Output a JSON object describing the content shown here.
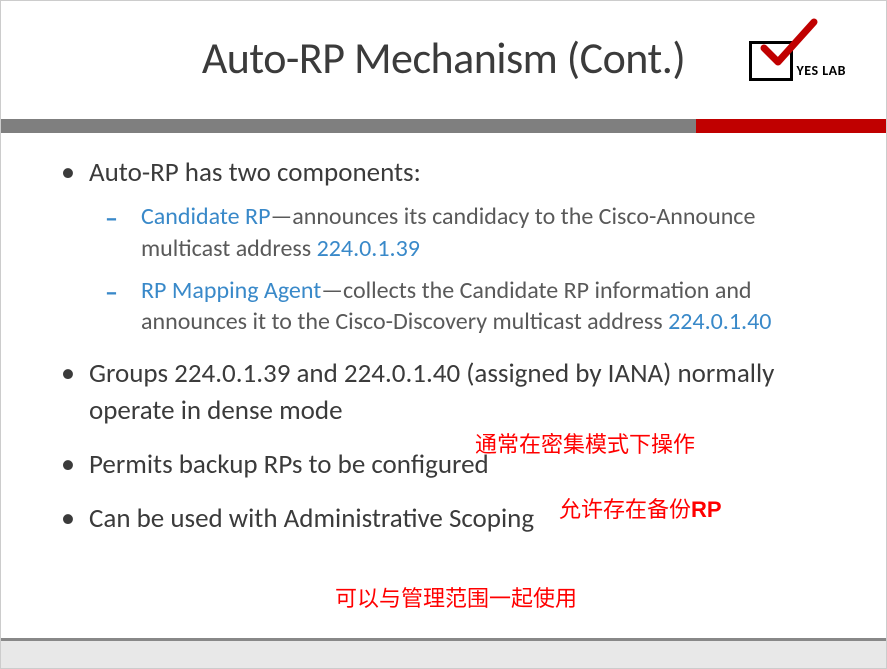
{
  "title": "Auto-RP Mechanism (Cont.)",
  "logo": {
    "text": "YES LAB"
  },
  "bullets": {
    "b1": {
      "text": "Auto-RP has two components:",
      "sub": {
        "s1": {
          "label": "Candidate RP",
          "rest_a": "—announces its candidacy to the Cisco-Announce multicast address ",
          "addr": "224.0.1.39"
        },
        "s2": {
          "label": "RP Mapping Agent",
          "rest_a": "—collects the Candidate RP information and announces it to the Cisco-Discovery multicast address ",
          "addr": "224.0.1.40"
        }
      }
    },
    "b2": "Groups 224.0.1.39 and 224.0.1.40 (assigned by IANA) normally operate in dense mode",
    "b3": "Permits backup RPs to be configured",
    "b4": "Can be used with Administrative Scoping"
  },
  "annotations": {
    "a1": "通常在密集模式下操作",
    "a2_pre": "允许存在备份",
    "a2_bold": "RP",
    "a3": "可以与管理范围一起使用"
  }
}
